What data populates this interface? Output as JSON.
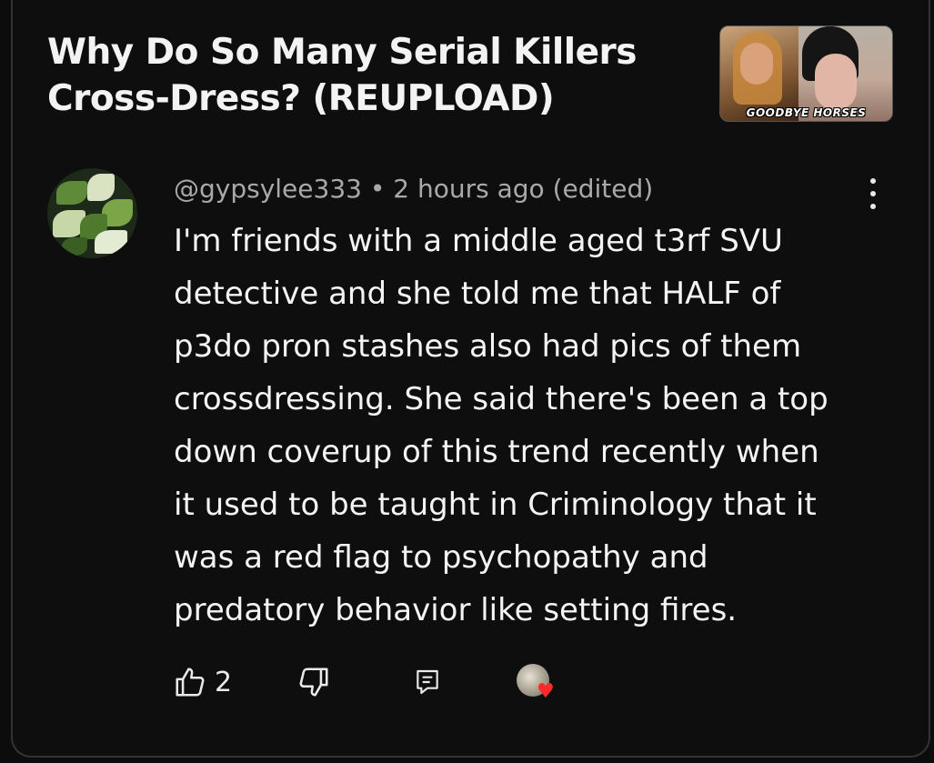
{
  "video": {
    "title": "Why Do So Many Serial Killers Cross-Dress? (REUPLOAD)",
    "thumbnail_caption": "GOODBYE HORSES"
  },
  "comment": {
    "handle": "@gypsylee333",
    "separator": " • ",
    "time": "2 hours ago (edited)",
    "lines": [
      "I'm friends with a middle aged t3rf SVU",
      "detective and she told me that HALF of",
      "p3do pron stashes also had pics of them",
      "crossdressing. She said there's been a top",
      "down coverup of this trend recently when",
      "it used to be taught in Criminology that it",
      "was a red flag to psychopathy and",
      "predatory behavior like setting fires."
    ],
    "like_count": "2"
  },
  "icons": {
    "more": "more-vertical-icon",
    "like": "thumbs-up-icon",
    "dislike": "thumbs-down-icon",
    "reply": "reply-icon",
    "creator_heart": "heart-icon"
  },
  "colors": {
    "background": "#0e0e0e",
    "meta_text": "#a9a9a9",
    "body_text": "#f4f4f4",
    "heart": "#ff2a2a"
  }
}
